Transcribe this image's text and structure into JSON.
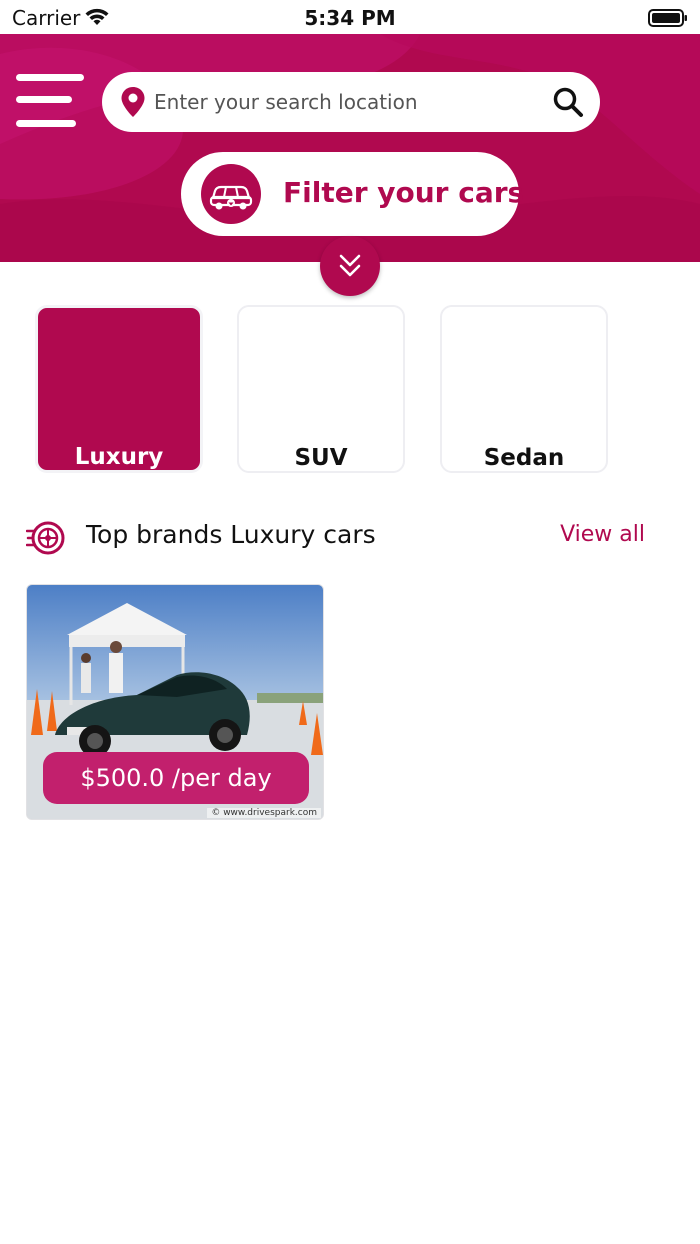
{
  "status_bar": {
    "carrier": "Carrier",
    "time": "5:34 PM"
  },
  "header": {
    "brand_color": "#b0094f",
    "search": {
      "placeholder": "Enter your search location",
      "value": ""
    },
    "filter_label": "Filter your cars"
  },
  "categories": [
    {
      "label": "Luxury",
      "selected": true
    },
    {
      "label": "SUV",
      "selected": false
    },
    {
      "label": "Sedan",
      "selected": false
    }
  ],
  "brands_section": {
    "title": "Top brands Luxury cars",
    "view_all_label": "View all"
  },
  "cars": [
    {
      "price_label": "$500.0 /per day",
      "watermark": "© www.drivespark.com"
    }
  ],
  "icons": {
    "menu": "menu-icon",
    "location": "location-pin-icon",
    "search": "search-icon",
    "filter": "car-icon",
    "expand": "double-chevron-down-icon",
    "brands": "wheel-icon"
  }
}
